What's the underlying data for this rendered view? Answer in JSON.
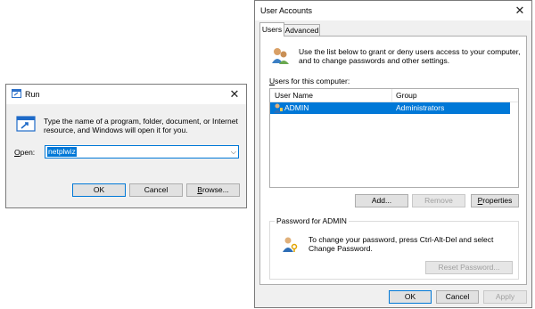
{
  "run": {
    "title": "Run",
    "description": "Type the name of a program, folder, document, or Internet resource, and Windows will open it for you.",
    "open_label": "Open:",
    "open_value": "netplwiz",
    "ok": "OK",
    "cancel": "Cancel",
    "browse": "Browse..."
  },
  "ua": {
    "title": "User Accounts",
    "tabs": [
      "Users",
      "Advanced"
    ],
    "intro": "Use the list below to grant or deny users access to your computer, and to change passwords and other settings.",
    "users_for_label": "Users for this computer:",
    "columns": [
      "User Name",
      "Group"
    ],
    "rows": [
      {
        "name": "ADMIN",
        "group": "Administrators"
      }
    ],
    "add": "Add...",
    "remove": "Remove",
    "properties": "Properties",
    "password_group_title": "Password for ADMIN",
    "password_text": "To change your password, press Ctrl-Alt-Del and select Change Password.",
    "reset_password": "Reset Password...",
    "ok": "OK",
    "cancel": "Cancel",
    "apply": "Apply"
  },
  "colors": {
    "selection": "#0078d7",
    "accent_border": "#0078d7",
    "disabled_text": "#a0a0a0"
  }
}
